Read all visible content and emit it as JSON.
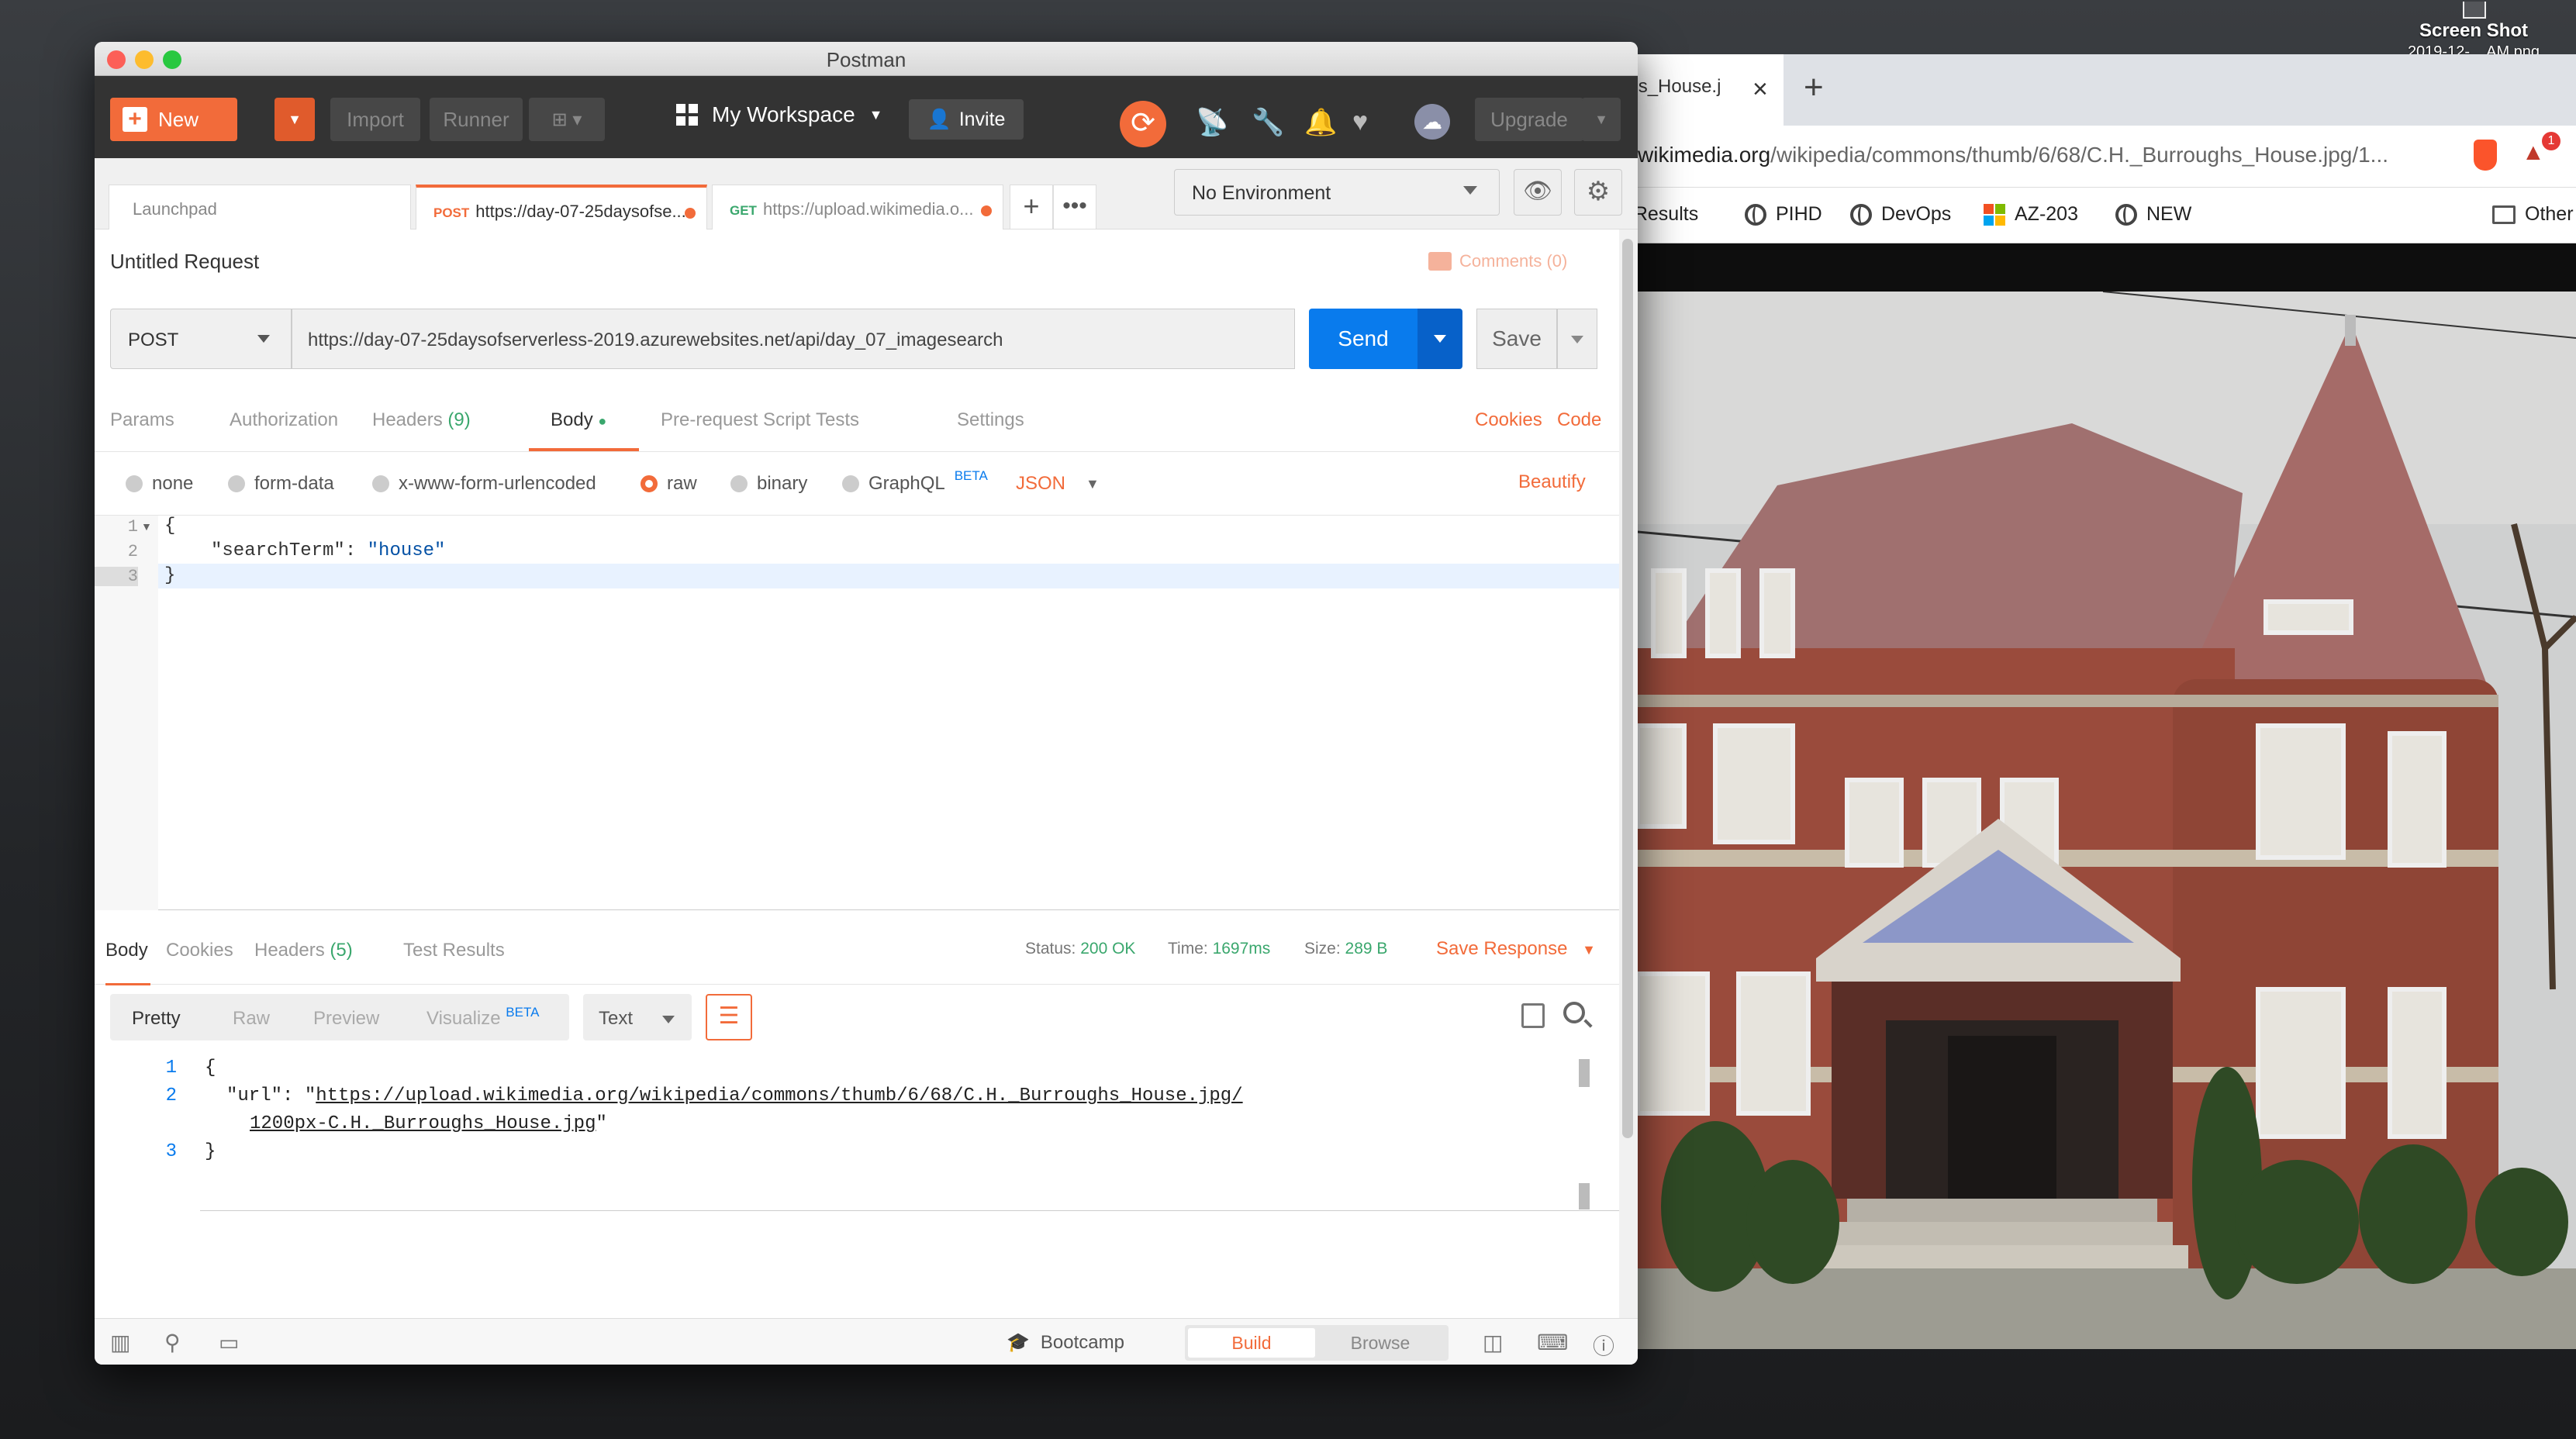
{
  "desktop": {
    "label": "Screen Shot",
    "sublabel": "2019-12-... AM.png"
  },
  "browser": {
    "tab_title": "ghs_House.j",
    "url_host": "wikimedia.org",
    "url_path": "/wikipedia/commons/thumb/6/68/C.H._Burroughs_House.jpg/1...",
    "extension_badge": "1",
    "bookmarks": [
      "g Results",
      "PIHD",
      "DevOps",
      "AZ-203",
      "NEW",
      "Other"
    ]
  },
  "postman": {
    "window_title": "Postman",
    "toolbar": {
      "new_label": "New",
      "import_label": "Import",
      "runner_label": "Runner",
      "workspace_label": "My Workspace",
      "invite_label": "Invite",
      "upgrade_label": "Upgrade"
    },
    "tabs": [
      {
        "method": "",
        "label": "Launchpad"
      },
      {
        "method": "POST",
        "label": "https://day-07-25daysofse..."
      },
      {
        "method": "GET",
        "label": "https://upload.wikimedia.o..."
      }
    ],
    "environment": "No Environment",
    "request": {
      "name": "Untitled Request",
      "comments_label": "Comments (0)",
      "method": "POST",
      "url": "https://day-07-25daysofserverless-2019.azurewebsites.net/api/day_07_imagesearch",
      "send_label": "Send",
      "save_label": "Save"
    },
    "request_tabs": {
      "params": "Params",
      "authorization": "Authorization",
      "headers": "Headers",
      "headers_count": "(9)",
      "body": "Body",
      "prerequest": "Pre-request Script",
      "tests": "Tests",
      "settings": "Settings",
      "cookies": "Cookies",
      "code": "Code"
    },
    "body_types": {
      "none": "none",
      "form_data": "form-data",
      "urlencoded": "x-www-form-urlencoded",
      "raw": "raw",
      "binary": "binary",
      "graphql": "GraphQL",
      "beta": "BETA",
      "json": "JSON",
      "beautify": "Beautify"
    },
    "request_body": {
      "line_numbers": [
        "1",
        "2",
        "3"
      ],
      "line1": "{",
      "line2_key": "\"searchTerm\"",
      "line2_sep": ": ",
      "line2_value": "\"house\"",
      "line3": "}"
    },
    "response_tabs": {
      "body": "Body",
      "cookies": "Cookies",
      "headers": "Headers",
      "headers_count": "(5)",
      "test_results": "Test Results"
    },
    "response_meta": {
      "status_label": "Status:",
      "status_value": "200 OK",
      "time_label": "Time:",
      "time_value": "1697ms",
      "size_label": "Size:",
      "size_value": "289 B",
      "save_response": "Save Response"
    },
    "response_view": {
      "pretty": "Pretty",
      "raw": "Raw",
      "preview": "Preview",
      "visualize": "Visualize",
      "beta": "BETA",
      "format": "Text"
    },
    "response_body": {
      "line_numbers": [
        "1",
        "2",
        "3"
      ],
      "line1": "{",
      "line2_prefix": "\"url\": \"",
      "line2_link": "https://upload.wikimedia.org/wikipedia/commons/thumb/6/68/C.H._Burroughs_House.jpg/",
      "line2b_link": "1200px-C.H._Burroughs_House.jpg",
      "line2b_suffix": "\"",
      "line3": "}"
    },
    "footer": {
      "bootcamp": "Bootcamp",
      "build": "Build",
      "browse": "Browse"
    }
  },
  "colors": {
    "accent": "#f26b3a",
    "send_blue": "#097bed",
    "status_green": "#3aa76d"
  }
}
